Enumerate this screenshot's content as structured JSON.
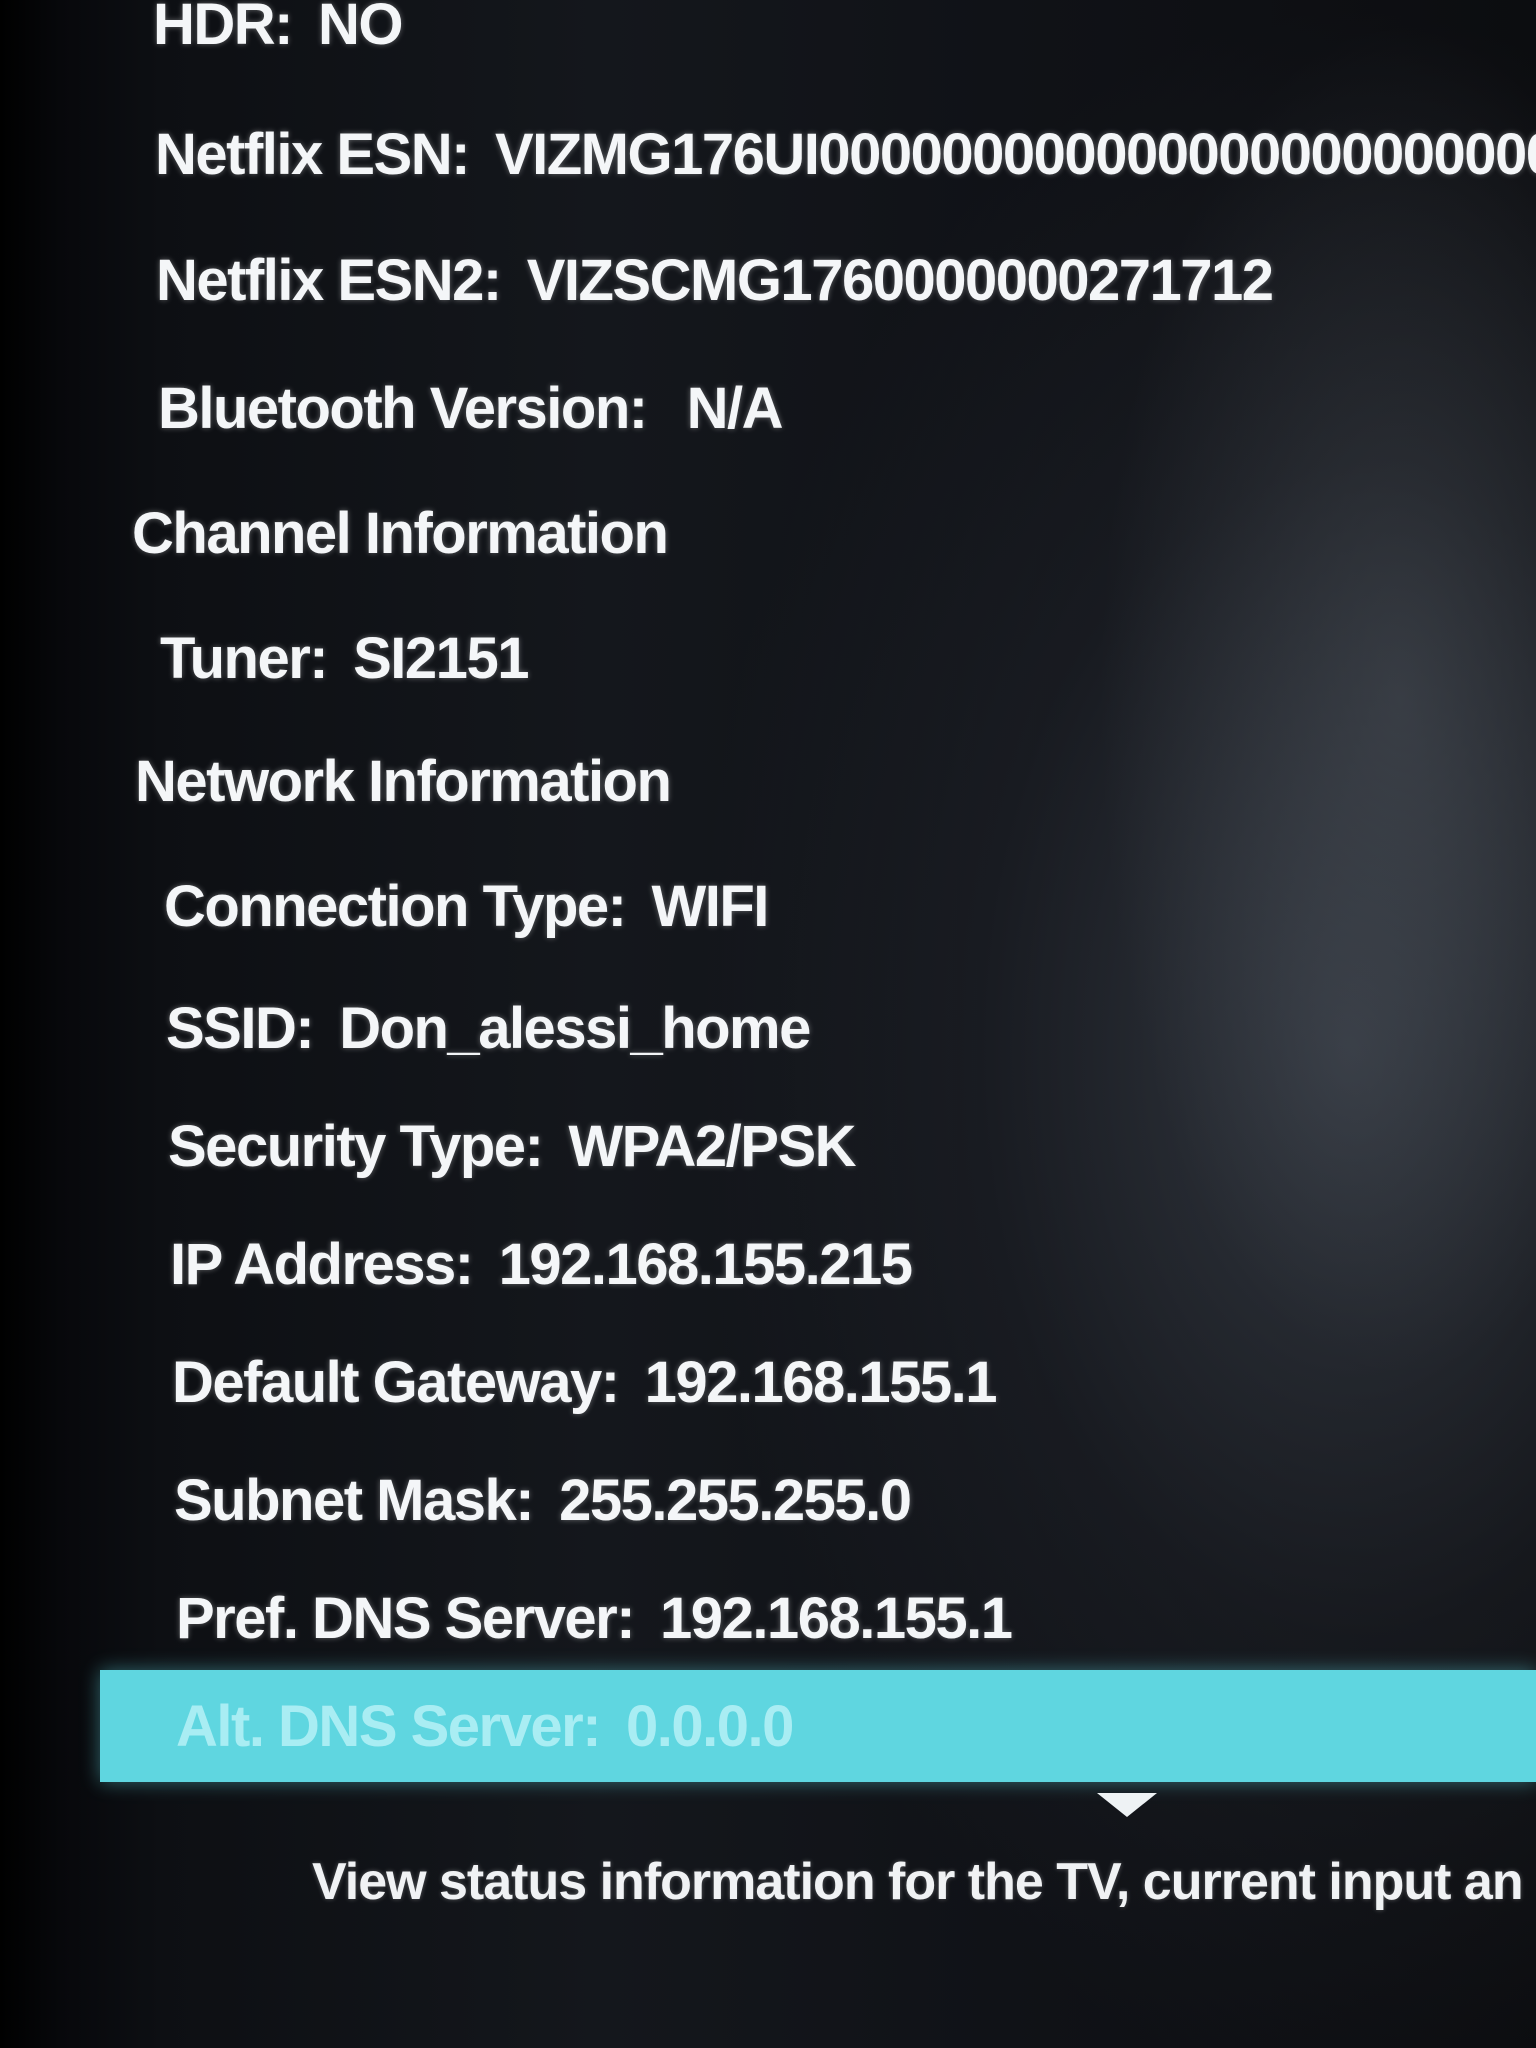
{
  "info": {
    "hdr": {
      "label": "HDR:",
      "value": "NO"
    },
    "netflix_esn": {
      "label": "Netflix ESN:",
      "value": "VIZMG176UI000000000000000000000000"
    },
    "netflix_esn2": {
      "label": "Netflix ESN2:",
      "value": "VIZSCMG1760000000271712"
    },
    "bluetooth_version": {
      "label": "Bluetooth Version:",
      "value": "N/A"
    }
  },
  "channel_information": {
    "heading": "Channel Information",
    "tuner": {
      "label": "Tuner:",
      "value": "SI2151"
    }
  },
  "network_information": {
    "heading": "Network Information",
    "connection_type": {
      "label": "Connection Type:",
      "value": "WIFI"
    },
    "ssid": {
      "label": "SSID:",
      "value": "Don_alessi_home"
    },
    "security_type": {
      "label": "Security Type:",
      "value": "WPA2/PSK"
    },
    "ip_address": {
      "label": "IP Address:",
      "value": "192.168.155.215"
    },
    "default_gateway": {
      "label": "Default Gateway:",
      "value": "192.168.155.1"
    },
    "subnet_mask": {
      "label": "Subnet Mask:",
      "value": "255.255.255.0"
    },
    "pref_dns_server": {
      "label": "Pref. DNS Server:",
      "value": "192.168.155.1"
    },
    "alt_dns_server": {
      "label": "Alt. DNS Server:",
      "value": "0.0.0.0"
    }
  },
  "footer": {
    "description": "View status information for the TV, current input an"
  },
  "colors": {
    "highlight": "#5fd6e0",
    "text": "#f4f6f8",
    "background": "#0d0f13"
  },
  "icons": {
    "scroll_indicator": "chevron-down-icon"
  }
}
